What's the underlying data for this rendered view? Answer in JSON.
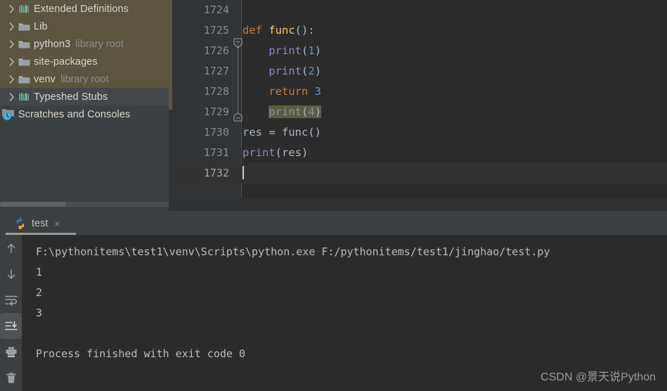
{
  "project_tree": {
    "items": [
      {
        "label": "Extended Definitions",
        "sub": "",
        "icon": "library-bars-icon",
        "twisty": "chevron-right-icon",
        "selected": false,
        "band": "olive"
      },
      {
        "label": "Lib",
        "sub": "",
        "icon": "folder-icon",
        "twisty": "chevron-right-icon",
        "selected": false,
        "band": "olive"
      },
      {
        "label": "python3",
        "sub": "library root",
        "icon": "folder-icon",
        "twisty": "chevron-right-icon",
        "selected": false,
        "band": "olive"
      },
      {
        "label": "site-packages",
        "sub": "",
        "icon": "folder-icon",
        "twisty": "chevron-right-icon",
        "selected": false,
        "band": "olive"
      },
      {
        "label": "venv",
        "sub": "library root",
        "icon": "folder-icon",
        "twisty": "chevron-right-icon",
        "selected": false,
        "band": "olive"
      },
      {
        "label": "Typeshed Stubs",
        "sub": "",
        "icon": "library-bars-icon",
        "twisty": "chevron-right-icon",
        "selected": true,
        "band": "dark"
      },
      {
        "label": "Scratches and Consoles",
        "sub": "",
        "icon": "scratches-clock-icon",
        "twisty": "",
        "selected": false,
        "band": "dark"
      }
    ]
  },
  "editor": {
    "lines": [
      {
        "no": "1724",
        "text": "",
        "current": false
      },
      {
        "no": "1725",
        "text": "def func():",
        "current": false
      },
      {
        "no": "1726",
        "text": "    print(1)",
        "current": false
      },
      {
        "no": "1727",
        "text": "    print(2)",
        "current": false
      },
      {
        "no": "1728",
        "text": "    return 3",
        "current": false
      },
      {
        "no": "1729",
        "text": "    print(4)",
        "current": false
      },
      {
        "no": "1730",
        "text": "res = func()",
        "current": false
      },
      {
        "no": "1731",
        "text": "print(res)",
        "current": false
      },
      {
        "no": "1732",
        "text": "",
        "current": true
      }
    ],
    "highlighted_fragment": "print(4)",
    "fold_markers": [
      "fold-collapse-icon",
      "fold-end-icon"
    ],
    "caret_line": "1732",
    "colors": {
      "keyword": "#cc7832",
      "function_name": "#ffc66d",
      "builtin": "#8888c6",
      "number": "#6897bb",
      "default_text": "#a9b7c6",
      "highlight_bg": "#5d5b3f",
      "editor_bg": "#2b2b2b",
      "gutter_bg": "#313335",
      "change_marker": "#5b543f"
    }
  },
  "console": {
    "tab": {
      "label": "test",
      "icon": "python-logo-icon",
      "close": "×"
    },
    "toolbar": [
      {
        "name": "scroll-up-icon",
        "active": false
      },
      {
        "name": "scroll-down-icon",
        "active": false
      },
      {
        "name": "soft-wrap-icon",
        "active": false
      },
      {
        "name": "scroll-to-end-icon",
        "active": true
      },
      {
        "name": "print-icon",
        "active": false
      },
      {
        "name": "clear-all-icon",
        "active": false
      }
    ],
    "output": [
      "F:\\pythonitems\\test1\\venv\\Scripts\\python.exe F:/pythonitems/test1/jinghao/test.py",
      "1",
      "2",
      "3",
      "",
      "Process finished with exit code 0"
    ]
  },
  "watermark": {
    "text": "CSDN @景天说Python"
  }
}
